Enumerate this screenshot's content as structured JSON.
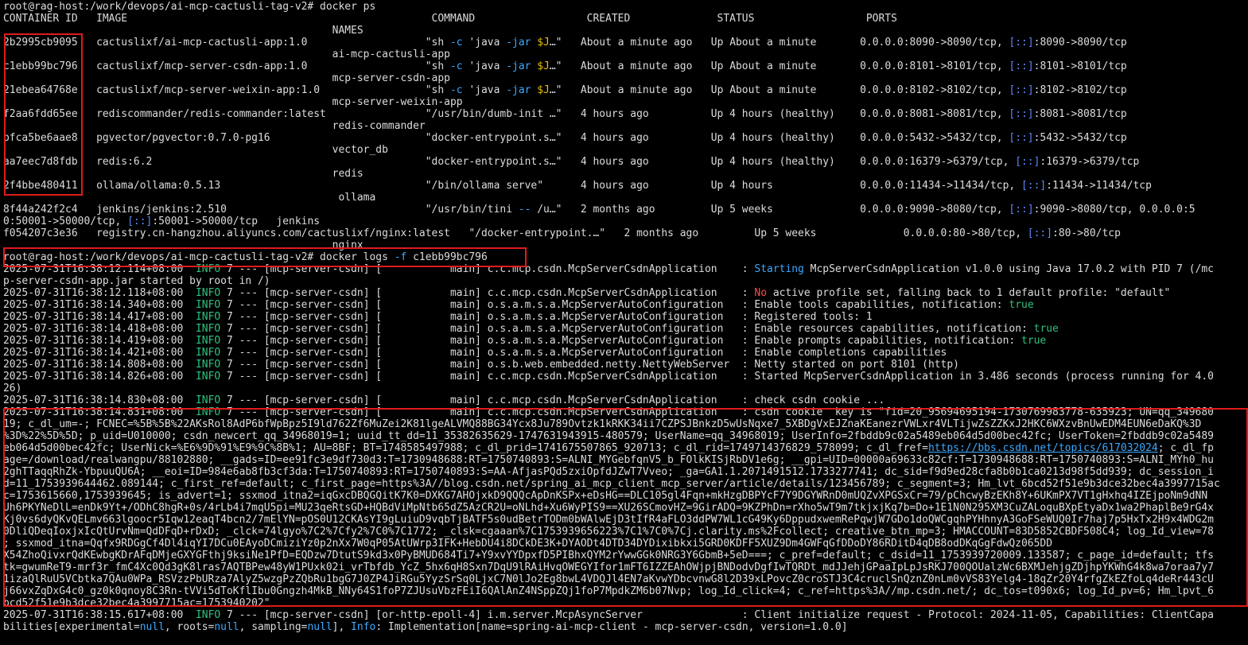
{
  "colors": {
    "background": "#000000",
    "text": "#dcdcdc",
    "info": "#2ec27e",
    "keyword": "#e5c000",
    "error": "#ff4c4c",
    "link": "#3da9ff",
    "ipv6": "#5f87ff",
    "highlight_box": "#e01b1b"
  },
  "lines": [
    [
      {
        "t": "root@rag-host:/work/devops/ai-mcp-cactusli-tag-v2# docker ps"
      }
    ],
    [
      {
        "t": "CONTAINER ID   IMAGE                                                 COMMAND                  CREATED              STATUS                  PORTS"
      }
    ],
    [
      {
        "t": "                                                     NAMES"
      }
    ],
    [
      {
        "t": "2b2995cb9095   cactuslixf/ai-mcp-cactusli-app:1.0                   \"sh "
      },
      {
        "t": "-c",
        "c": "c"
      },
      {
        "t": " 'java "
      },
      {
        "t": "-jar",
        "c": "c"
      },
      {
        "t": " "
      },
      {
        "t": "$J",
        "c": "y"
      },
      {
        "t": "…\"   About a minute ago   Up About a minute       0.0.0.0:8090->8090/tcp, "
      },
      {
        "t": "[::]",
        "c": "b"
      },
      {
        "t": ":8090->8090/tcp"
      }
    ],
    [
      {
        "t": "                                                     ai-mcp-cactusli-app"
      }
    ],
    [
      {
        "t": "c1ebb99bc796   cactuslixf/mcp-server-csdn-app:1.0                   \"sh "
      },
      {
        "t": "-c",
        "c": "c"
      },
      {
        "t": " 'java "
      },
      {
        "t": "-jar",
        "c": "c"
      },
      {
        "t": " "
      },
      {
        "t": "$J",
        "c": "y"
      },
      {
        "t": "…\"   About a minute ago   Up About a minute       0.0.0.0:8101->8101/tcp, "
      },
      {
        "t": "[::]",
        "c": "b"
      },
      {
        "t": ":8101->8101/tcp"
      }
    ],
    [
      {
        "t": "                                                     mcp-server-csdn-app"
      }
    ],
    [
      {
        "t": "21ebea64768e   cactuslixf/mcp-server-weixin-app:1.0                 \"sh "
      },
      {
        "t": "-c",
        "c": "c"
      },
      {
        "t": " 'java "
      },
      {
        "t": "-jar",
        "c": "c"
      },
      {
        "t": " "
      },
      {
        "t": "$J",
        "c": "y"
      },
      {
        "t": "…\"   About a minute ago   Up About a minute       0.0.0.0:8102->8102/tcp, "
      },
      {
        "t": "[::]",
        "c": "b"
      },
      {
        "t": ":8102->8102/tcp"
      }
    ],
    [
      {
        "t": "                                                     mcp-server-weixin-app"
      }
    ],
    [
      {
        "t": "f2aa6fdd65ee   rediscommander/redis-commander:latest                \"/usr/bin/dumb-init …\"   4 hours ago          Up 4 hours (healthy)    0.0.0.0:8081->8081/tcp, "
      },
      {
        "t": "[::]",
        "c": "b"
      },
      {
        "t": ":8081->8081/tcp"
      }
    ],
    [
      {
        "t": "                                                     redis-commander"
      }
    ],
    [
      {
        "t": "bfca5be6aae8   pgvector/pgvector:0.7.0-pg16                         \"docker-entrypoint.s…\"   4 hours ago          Up 4 hours (healthy)    0.0.0.0:5432->5432/tcp, "
      },
      {
        "t": "[::]",
        "c": "b"
      },
      {
        "t": ":5432->5432/tcp"
      }
    ],
    [
      {
        "t": "                                                     vector_db"
      }
    ],
    [
      {
        "t": "aa7eec7d8fdb   redis:6.2                                            \"docker-entrypoint.s…\"   4 hours ago          Up 4 hours (healthy)    0.0.0.0:16379->6379/tcp, "
      },
      {
        "t": "[::]",
        "c": "b"
      },
      {
        "t": ":16379->6379/tcp"
      }
    ],
    [
      {
        "t": "                                                     redis"
      }
    ],
    [
      {
        "t": "2f4bbe480411   ollama/ollama:0.5.13                                 \"/bin/ollama serve\"      4 hours ago          Up 4 hours              0.0.0.0:11434->11434/tcp, "
      },
      {
        "t": "[::]",
        "c": "b"
      },
      {
        "t": ":11434->11434/tcp"
      }
    ],
    [
      {
        "t": "                                                      ollama"
      }
    ],
    [
      {
        "t": "8f44a242f2c4   jenkins/jenkins:2.510                                \"/usr/bin/tini "
      },
      {
        "t": "--",
        "c": "c"
      },
      {
        "t": " /u…\"   2 months ago         Up 5 weeks              0.0.0.0:9090->8080/tcp, "
      },
      {
        "t": "[::]",
        "c": "b"
      },
      {
        "t": ":9090->8080/tcp, 0.0.0.0:5"
      }
    ],
    [
      {
        "t": "0:50001->50000/tcp, "
      },
      {
        "t": "[::]",
        "c": "b"
      },
      {
        "t": ":50001->50000/tcp   jenkins"
      }
    ],
    [
      {
        "t": "f054207c3e36   registry.cn-hangzhou.aliyuncs.com/cactuslixf/nginx:latest   \"/docker-entrypoint.…\"   2 months ago         Up 5 weeks              0.0.0.0:80->80/tcp, "
      },
      {
        "t": "[::]",
        "c": "b"
      },
      {
        "t": ":80->80/tcp"
      }
    ],
    [
      {
        "t": "                                                     nginx"
      }
    ],
    [
      {
        "t": "root@rag-host:/work/devops/ai-mcp-cactusli-tag-v2# docker logs "
      },
      {
        "t": "-f",
        "c": "c"
      },
      {
        "t": " c1ebb99bc796"
      }
    ],
    [
      {
        "t": "2025-07-31T16:38:12.114+08:00  "
      },
      {
        "t": "INFO",
        "c": "g"
      },
      {
        "t": " 7 --- [mcp-server-csdn] [           main] c.c.mcp.csdn.McpServerCsdnApplication    : "
      },
      {
        "t": "Starting",
        "c": "c"
      },
      {
        "t": " McpServerCsdnApplication v1.0.0 using Java 17.0.2 with PID 7 (/mc"
      }
    ],
    [
      {
        "t": "p-server-csdn-app.jar started by root in /)"
      }
    ],
    [
      {
        "t": "2025-07-31T16:38:12.118+08:00  "
      },
      {
        "t": "INFO",
        "c": "g"
      },
      {
        "t": " 7 --- [mcp-server-csdn] [           main] c.c.mcp.csdn.McpServerCsdnApplication    : "
      },
      {
        "t": "No",
        "c": "r"
      },
      {
        "t": " active profile set, falling back to 1 default profile: \"default\""
      }
    ],
    [
      {
        "t": "2025-07-31T16:38:14.340+08:00  "
      },
      {
        "t": "INFO",
        "c": "g"
      },
      {
        "t": " 7 --- [mcp-server-csdn] [           main] o.s.a.m.s.a.McpServerAutoConfiguration   : Enable tools capabilities, notification: "
      },
      {
        "t": "true",
        "c": "g"
      }
    ],
    [
      {
        "t": "2025-07-31T16:38:14.417+08:00  "
      },
      {
        "t": "INFO",
        "c": "g"
      },
      {
        "t": " 7 --- [mcp-server-csdn] [           main] o.s.a.m.s.a.McpServerAutoConfiguration   : Registered tools: 1"
      }
    ],
    [
      {
        "t": "2025-07-31T16:38:14.418+08:00  "
      },
      {
        "t": "INFO",
        "c": "g"
      },
      {
        "t": " 7 --- [mcp-server-csdn] [           main] o.s.a.m.s.a.McpServerAutoConfiguration   : Enable resources capabilities, notification: "
      },
      {
        "t": "true",
        "c": "g"
      }
    ],
    [
      {
        "t": "2025-07-31T16:38:14.419+08:00  "
      },
      {
        "t": "INFO",
        "c": "g"
      },
      {
        "t": " 7 --- [mcp-server-csdn] [           main] o.s.a.m.s.a.McpServerAutoConfiguration   : Enable prompts capabilities, notification: "
      },
      {
        "t": "true",
        "c": "g"
      }
    ],
    [
      {
        "t": "2025-07-31T16:38:14.421+08:00  "
      },
      {
        "t": "INFO",
        "c": "g"
      },
      {
        "t": " 7 --- [mcp-server-csdn] [           main] o.s.a.m.s.a.McpServerAutoConfiguration   : Enable completions capabilities"
      }
    ],
    [
      {
        "t": "2025-07-31T16:38:14.808+08:00  "
      },
      {
        "t": "INFO",
        "c": "g"
      },
      {
        "t": " 7 --- [mcp-server-csdn] [           main] o.s.b.web.embedded.netty.NettyWebServer  : Netty started on port 8101 (http)"
      }
    ],
    [
      {
        "t": "2025-07-31T16:38:14.826+08:00  "
      },
      {
        "t": "INFO",
        "c": "g"
      },
      {
        "t": " 7 --- [mcp-server-csdn] [           main] c.c.mcp.csdn.McpServerCsdnApplication    : Started McpServerCsdnApplication in 3.486 seconds (process running for 4.0"
      }
    ],
    [
      {
        "t": "26)"
      }
    ],
    [
      {
        "t": "2025-07-31T16:38:14.830+08:00  "
      },
      {
        "t": "INFO",
        "c": "g"
      },
      {
        "t": " 7 --- [mcp-server-csdn] [           main] c.c.mcp.csdn.McpServerCsdnApplication    : check csdn cookie ..."
      }
    ],
    [
      {
        "t": "2025-07-31T16:38:14.831+08:00  "
      },
      {
        "t": "INFO",
        "c": "g"
      },
      {
        "t": " 7 --- [mcp-server-csdn] [           main] c.c.mcp.csdn.McpServerCsdnApplication    : csdn cookie  key is \"fid=20_95694695194-1730769983778-635923; UN=qq_349680"
      }
    ],
    [
      {
        "t": "19; c_dl_um=-; FCNEC=%5B%5B%22AKsRol8AdP6bfWpBpz5I9ld762Zf6MuZei2K81lgeALVMQ88BG34Ycx8Ju789Ovtzk1kRKK34ii7CZPSJBnkzD5wUsNqxe7_5XBDgVxEJZnaKEanezrVWLxr4VLTijwZsZZKxJ2HKC6WXzvBnUwEDM4EUN6eDaKQ%3D"
      }
    ],
    [
      {
        "t": "%3D%22%5D%5D; p_uid=U010000; csdn_newcert_qq_34968019=1; uuid_tt_dd=11_35382635629-1747631943915-480579; UserName=qq_34968019; UserInfo=2fbddb9c02a5489eb064d5d00bec42fc; UserToken=2fbddb9c02a5489"
      }
    ],
    [
      {
        "t": "eb064d5d00bec42fc; UserNick=%E6%9D%91%E9%9C%8B%1; AU=8BF; BT=1748585497988; c_dl_prid=1741675507865_920713; c_dl_rid=1749714376829_578099; c_dl_fref="
      },
      {
        "t": "https://bbs.csdn.net/topics/617032024",
        "c": "c",
        "u": true
      },
      {
        "t": "; c_dl_fp"
      }
    ],
    [
      {
        "t": "age=/download/realwangpu/88102880; __gads=ID=ee91fc3e9df730d3:T=1730948688:RT=1750740893:S=ALNI_MYGebfqnV5_b_FOlkKISjRbDV1e6g; __gpi=UID=00000a69633c82cf:T=1730948688:RT=1750740893:S=ALNI_MYh0_hu"
      }
    ],
    [
      {
        "t": "2ghTTaqqRhZk-YbpuuQU6A; __eoi=ID=984e6ab8fb3cf3da:T=1750740893:RT=1750740893:S=AA-AfjasPQd5zxiOpfdJZwT7Vveo; _ga=GA1.1.2071491512.1733277741; dc_sid=f9d9ed28cfa8b0b1ca0213d98f5dd939; dc_session_i"
      }
    ],
    [
      {
        "t": "d=11_1753939644462.089144; c_first_ref=default; c_first_page=https%3A//blog.csdn.net/spring_ai_mcp_client_mcp_server/article/details/123456789; c_segment=3; Hm_lvt_6bcd52f51e9b3dce32bec4a3997715ac"
      }
    ],
    [
      {
        "t": "c=1753615660,1753939645; is_advert=1; ssxmod_itna2=iqGxcDBQGQitK7K0=DXKG7AHOjxkD9QQQcApDnKSPx+eDsHG==DLC105gl4Fqn+mkHzgDBPYcF7Y9DGYWRnD0mUQZvXPGSxCr=79/pChcwyBzEKh8Y+6UKmPX7VT1gHxhq4IZEjpoNm9dNN"
      }
    ],
    [
      {
        "t": "Uh6PKYNeDlL=enDk9Yt+/ODhC8hgR+0s/4rLb4i7mqU5pi=MU23qeRtsGD+HQBdViMpNtb65dZ5AzCR2U=oNLhd+Xu6WyPIS9==XU26SCmovHZ=9GirADQ=9KZPhDn=rXho5wT9m7tkjxjKq7b=Do+1E1N0N295XM3CuZALoquBXpEtyaDx1wa2PhaplBe9rG4x"
      }
    ],
    [
      {
        "t": "Kj0vs6dyQKvQELmv663lgoocr5Iqw12eaqT4bcn2/7mElYN=pOS0U12CKAsYI9gLuiuD9vqbTjBATF5s0udBetrTODm0bWAlwEjD3tIfR4aFLO3ddPW7WL1cG49Ky6DppudxwemRePqwjW7GDo1doQWCgqhPYHhnyA3GoFSeWUQ0Ir7haj7p5HxTx2H9x4WDG2m"
      }
    ],
    [
      {
        "t": "0DliQDeqIoxjxIcQtUrvNm=QdDFqD+rDxD; _clck=74lgyo%7C2%7Cfy2%7C0%7C1772; _clsk=cgaaan%7C1753939656223%7C1%7C0%7Cj.clarity.ms%2Fcollect; creative_btn_mp=3; HMACCOUNT=83D5852CBDF508C4; log_Id_view=78"
      }
    ],
    [
      {
        "t": "; ssxmod_itna=Qqfx9RDGgCf4Dl4iqYI7DCu0EAyoDCmiziYz0p2nXx7W0qP05AtUWrp3IFK+HebDU4i8DCkDE3K+DYAODt4DTD34DYDixibkxi5GRD0KDFF5XUZ9Dm4GWFqGfDDoDY86RDitD4qDB8odDKqGgFdwQz065DD"
      }
    ],
    [
      {
        "t": "X54ZhoQivxrQdKEwbgKDrAFqDMjeGXYGFthj9ksiNe1PfD=EQDzw7DtutS9kd3x0PyBMUD684Ti7+Y9xvYYDpxfD5PIBhxQYM2rYwwGGk0NRG3Y6GbmB+5eD===; c_pref=default; c_dsid=11_1753939720009.133587; c_page_id=default; tfs"
      }
    ],
    [
      {
        "t": "tk=gwumReT9-mrf3r_fmC4Xc0Qd3gK8lras7AQTBPew48yW1PUxk02i_vrTbfdb_YcZ_5hx6qH8Sxn7DqU9lRAiHvqOWEGYIfor1mFT6IZZEAhOWjpjBNDodvDgfIwTQRDt_mdJJehjGPaaIpLpJsRKJ700QOUalzWc6BXMJehjgZDjhpYKWhG4k8wa7oraa7y7"
      }
    ],
    [
      {
        "t": "1izaQlRuU5VCbtka7QAu0WPa_RSVzzPbURza7AlyZ5wzgPzZQbRu1bgG7J0ZP4JiRGu5YyzSrSq0LjxC7N0lJo2Eg8bwL4VDQJl4EN7aKvwYDbcvnwG8l2D39xLPovcZ0croSTJ3C4cruclSnQznZ0nLm0vVS83Yelg4-18qZr20Y4rfgZkEZfoLq4deRr443cU"
      }
    ],
    [
      {
        "t": "j66vxZqDxG4c0_gz0k0qnoy8C3Rn-tVVi5dToKflIbu0Gngzh4MkB_NNy64S1foP7ZJUsuVbzFEiI6QAlAnZ4NSppZQj1foP7MpdkZM6b07Nvp; log_Id_click=4; c_ref=https%3A//mp.csdn.net/; dc_tos=t090x6; log_Id_pv=6; Hm_lpvt_6"
      }
    ],
    [
      {
        "t": "bcd52f51e9b3dce32bec4a3997715ac=1753940202\""
      }
    ],
    [
      {
        "t": "2025-07-31T16:38:15.617+08:00  "
      },
      {
        "t": "INFO",
        "c": "g"
      },
      {
        "t": " 7 --- [mcp-server-csdn] [or-http-epoll-4] i.m.server.McpAsyncServer                : Client initialize request - Protocol: 2024-11-05, Capabilities: ClientCapa"
      }
    ],
    [
      {
        "t": "bilities[experimental="
      },
      {
        "t": "null",
        "c": "c"
      },
      {
        "t": ", roots="
      },
      {
        "t": "null",
        "c": "c"
      },
      {
        "t": ", sampling="
      },
      {
        "t": "null",
        "c": "c"
      },
      {
        "t": "], "
      },
      {
        "t": "Info",
        "c": "c"
      },
      {
        "t": ": Implementation[name=spring-ai-mcp-client - mcp-server-csdn, version=1.0.0]"
      }
    ],
    [
      {
        "t": ""
      }
    ]
  ]
}
